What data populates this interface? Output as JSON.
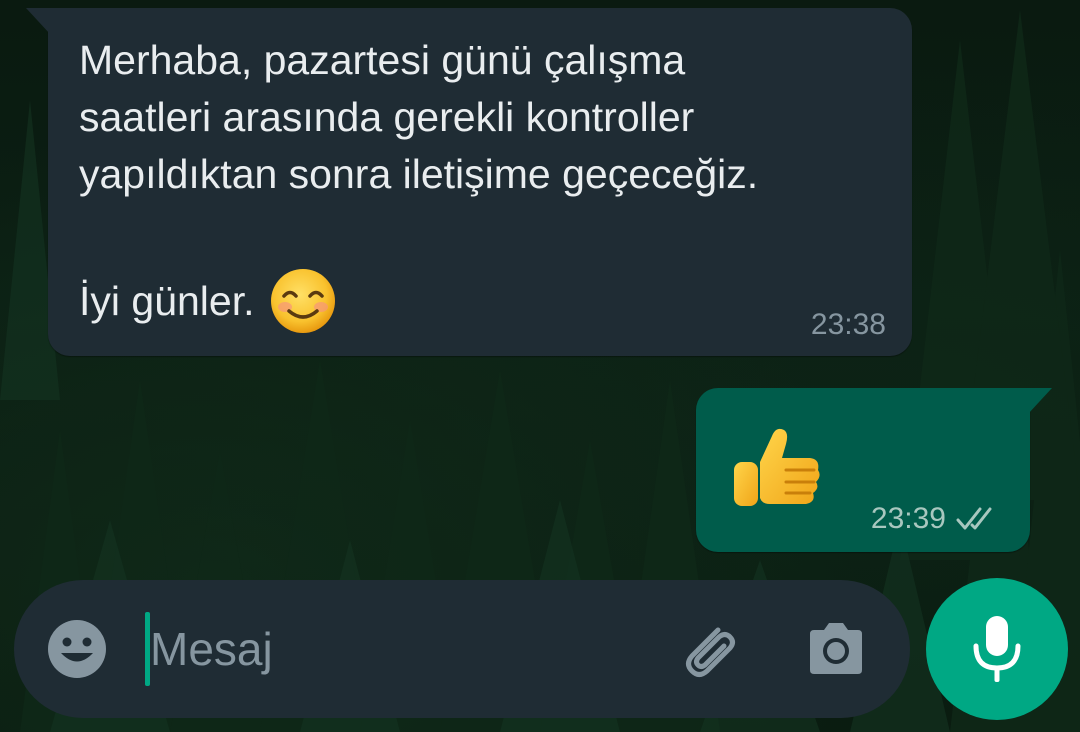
{
  "messages": [
    {
      "direction": "incoming",
      "text": "Merhaba, pazartesi günü çalışma\nsaatleri arasında gerekli kontroller\nyapıldıktan sonra iletişime geçeceğiz.",
      "greeting": "İyi günler.",
      "emoji": "smiling-face-with-smiling-eyes",
      "time": "23:38"
    },
    {
      "direction": "outgoing",
      "emoji": "thumbs-up",
      "time": "23:39",
      "status": "delivered-double-tick"
    }
  ],
  "composer": {
    "placeholder": "Mesaj",
    "value": "",
    "emoji_icon": "smiley-icon",
    "attach_icon": "paperclip-icon",
    "camera_icon": "camera-icon",
    "mic_icon": "microphone-icon"
  },
  "colors": {
    "incoming_bubble": "#1f2c34",
    "outgoing_bubble": "#005c4b",
    "accent": "#00a884",
    "text_primary": "#e9edef",
    "text_secondary": "#8696a0"
  }
}
